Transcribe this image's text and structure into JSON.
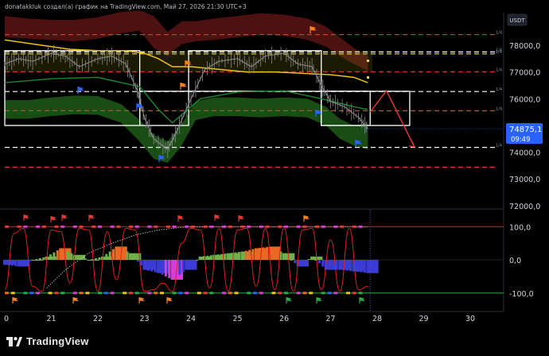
{
  "header": {
    "title": "donatakkluk создал(а) график на TradingView.com, Май 27, 2026 21:30 UTC+3",
    "currency": "USDT"
  },
  "price_badge": {
    "price": "74875,1",
    "countdown": "09:49"
  },
  "footer": {
    "brand": "TradingView"
  },
  "colors": {
    "background": "#000000",
    "price_badge": "#2962ff",
    "red_line": "#e53935",
    "yellow_line": "#f0c020",
    "green_band": "#1b5e20",
    "red_band": "#6d1515",
    "oscillator": "#e02020"
  },
  "chart_data": [
    {
      "type": "line",
      "name": "price-pane",
      "title": "",
      "x_ticks": [
        "0",
        "21",
        "22",
        "23",
        "24",
        "25",
        "26",
        "27",
        "28",
        "29",
        "30"
      ],
      "y_ticks": [
        "78000,0",
        "77000,0",
        "76000,0",
        "75000,0",
        "74000,0",
        "73000,0",
        "72000,0"
      ],
      "ylim": [
        72000,
        78700
      ],
      "grid": false,
      "last_price": 74875.1,
      "horizontal_levels": [
        {
          "price": 78400,
          "style": "dashed",
          "color": "#e53935"
        },
        {
          "price": 77750,
          "style": "dashed",
          "color": "#ffffff"
        },
        {
          "price": 77680,
          "style": "dashed",
          "color": "#e6d23a"
        },
        {
          "price": 77010,
          "style": "dashed",
          "color": "#e53935"
        },
        {
          "price": 76270,
          "style": "dashed",
          "color": "#ffffff"
        },
        {
          "price": 75550,
          "style": "dashed",
          "color": "#e53935"
        },
        {
          "price": 74180,
          "style": "dashed",
          "color": "#ffffff"
        },
        {
          "price": 73440,
          "style": "dashed",
          "color": "#e53935"
        }
      ],
      "level_tags": [
        "1/4",
        "1/4",
        "1/4",
        "1/4",
        "1/4",
        "1/4",
        "1/4"
      ],
      "boxes": [
        {
          "x0": 20.0,
          "x1": 22.9,
          "y0": 75000,
          "y1": 77800
        },
        {
          "x0": 22.9,
          "x1": 23.95,
          "y0": 75000,
          "y1": 76280
        },
        {
          "x0": 23.95,
          "x1": 26.8,
          "y0": 76280,
          "y1": 77800
        },
        {
          "x0": 26.8,
          "x1": 27.85,
          "y0": 75000,
          "y1": 76280
        }
      ],
      "price_series": {
        "x": [
          20.0,
          20.3,
          20.6,
          21.0,
          21.3,
          21.6,
          22.0,
          22.3,
          22.6,
          22.85,
          23.0,
          23.2,
          23.5,
          23.7,
          24.0,
          24.3,
          24.6,
          25.0,
          25.3,
          25.6,
          26.0,
          26.3,
          26.6,
          26.8,
          27.0,
          27.3,
          27.6,
          27.8
        ],
        "y": [
          77300,
          77500,
          77400,
          77700,
          77600,
          77200,
          77500,
          77600,
          77300,
          76300,
          75300,
          74500,
          74100,
          74800,
          76000,
          77100,
          77400,
          77500,
          77200,
          77600,
          77700,
          77300,
          77200,
          76500,
          75900,
          75700,
          75300,
          74875
        ]
      },
      "yellow_series": {
        "x": [
          20.0,
          20.8,
          21.4,
          22.0,
          22.6,
          23.0,
          23.3,
          23.6,
          24.0,
          24.6,
          25.2,
          25.8,
          26.4,
          27.0,
          27.5,
          27.8
        ],
        "y": [
          78200,
          78000,
          77850,
          77800,
          77800,
          77700,
          77500,
          77200,
          77200,
          77100,
          77000,
          77000,
          76950,
          76900,
          76800,
          76600
        ]
      },
      "projection": {
        "x": [
          27.85,
          28.2,
          28.8
        ],
        "y": [
          75500,
          76300,
          74200
        ]
      },
      "annotations": [
        "flag-blue",
        "flag-orange"
      ]
    },
    {
      "type": "line",
      "name": "oscillator-pane",
      "title": "",
      "y_ticks": [
        "100,0",
        "0,0",
        "-100,0"
      ],
      "ylim": [
        -140,
        140
      ],
      "grid": false,
      "levels": [
        100,
        0,
        -100
      ],
      "series": [
        {
          "x": [
            20.0,
            20.2,
            20.4,
            20.6,
            20.8,
            21.0,
            21.2,
            21.4,
            21.6,
            21.8,
            22.0,
            22.2,
            22.4,
            22.6,
            22.8,
            23.0,
            23.2,
            23.4,
            23.6,
            23.8,
            24.0,
            24.2,
            24.4,
            24.6,
            24.8,
            25.0,
            25.2,
            25.4,
            25.6,
            25.8,
            26.0,
            26.2,
            26.4,
            26.6,
            26.8,
            27.0,
            27.2,
            27.4,
            27.6,
            27.8
          ],
          "y": [
            -90,
            80,
            95,
            -80,
            -95,
            90,
            85,
            -70,
            95,
            90,
            -95,
            85,
            -60,
            95,
            90,
            -95,
            -90,
            -70,
            -95,
            50,
            95,
            90,
            -85,
            95,
            -95,
            90,
            95,
            -80,
            95,
            -90,
            95,
            -95,
            90,
            95,
            -90,
            60,
            -95,
            95,
            -90,
            -80
          ]
        }
      ],
      "histogram": {
        "x": [
          20.0,
          20.3,
          20.6,
          20.9,
          21.2,
          21.5,
          21.8,
          22.1,
          22.4,
          22.7,
          23.0,
          23.3,
          23.6,
          23.9,
          24.2,
          24.5,
          24.8,
          25.1,
          25.4,
          25.7,
          26.0,
          26.3,
          26.6,
          26.9,
          27.2,
          27.5,
          27.8
        ],
        "y": [
          -15,
          -20,
          0,
          10,
          35,
          15,
          0,
          10,
          40,
          20,
          -30,
          -40,
          -60,
          -30,
          10,
          15,
          20,
          25,
          35,
          40,
          20,
          -20,
          10,
          -30,
          -30,
          -35,
          -40
        ]
      }
    }
  ]
}
